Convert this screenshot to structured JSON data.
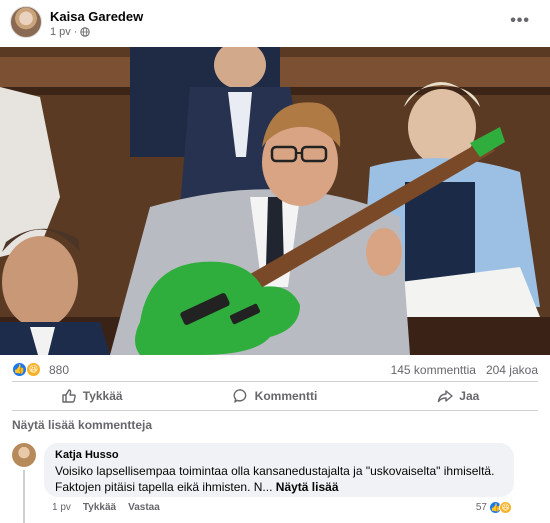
{
  "post": {
    "author": "Kaisa Garedew",
    "time": "1 pv",
    "more_label": "•••"
  },
  "stats": {
    "reaction_count": "880",
    "comments": "145 kommenttia",
    "shares": "204 jakoa"
  },
  "actions": {
    "like": "Tykkää",
    "comment": "Kommentti",
    "share": "Jaa"
  },
  "comments_section": {
    "more_comments": "Näytä lisää kommentteja",
    "comment": {
      "author": "Katja Husso",
      "text": "Voisiko lapsellisempaa toimintaa olla kansanedustajalta ja \"uskovaiselta\" ihmiseltä. Faktojen pitäisi tapella eikä ihmisten. N...",
      "see_more": "Näytä lisää",
      "time": "1 pv",
      "like": "Tykkää",
      "reply": "Vastaa",
      "reaction_count": "57"
    }
  },
  "colors": {
    "like_blue": "#1877f2",
    "haha_yellow": "#f7b125",
    "meta_gray": "#65676b",
    "bubble_bg": "#f0f2f5",
    "guitar_green": "#2fae3e"
  }
}
